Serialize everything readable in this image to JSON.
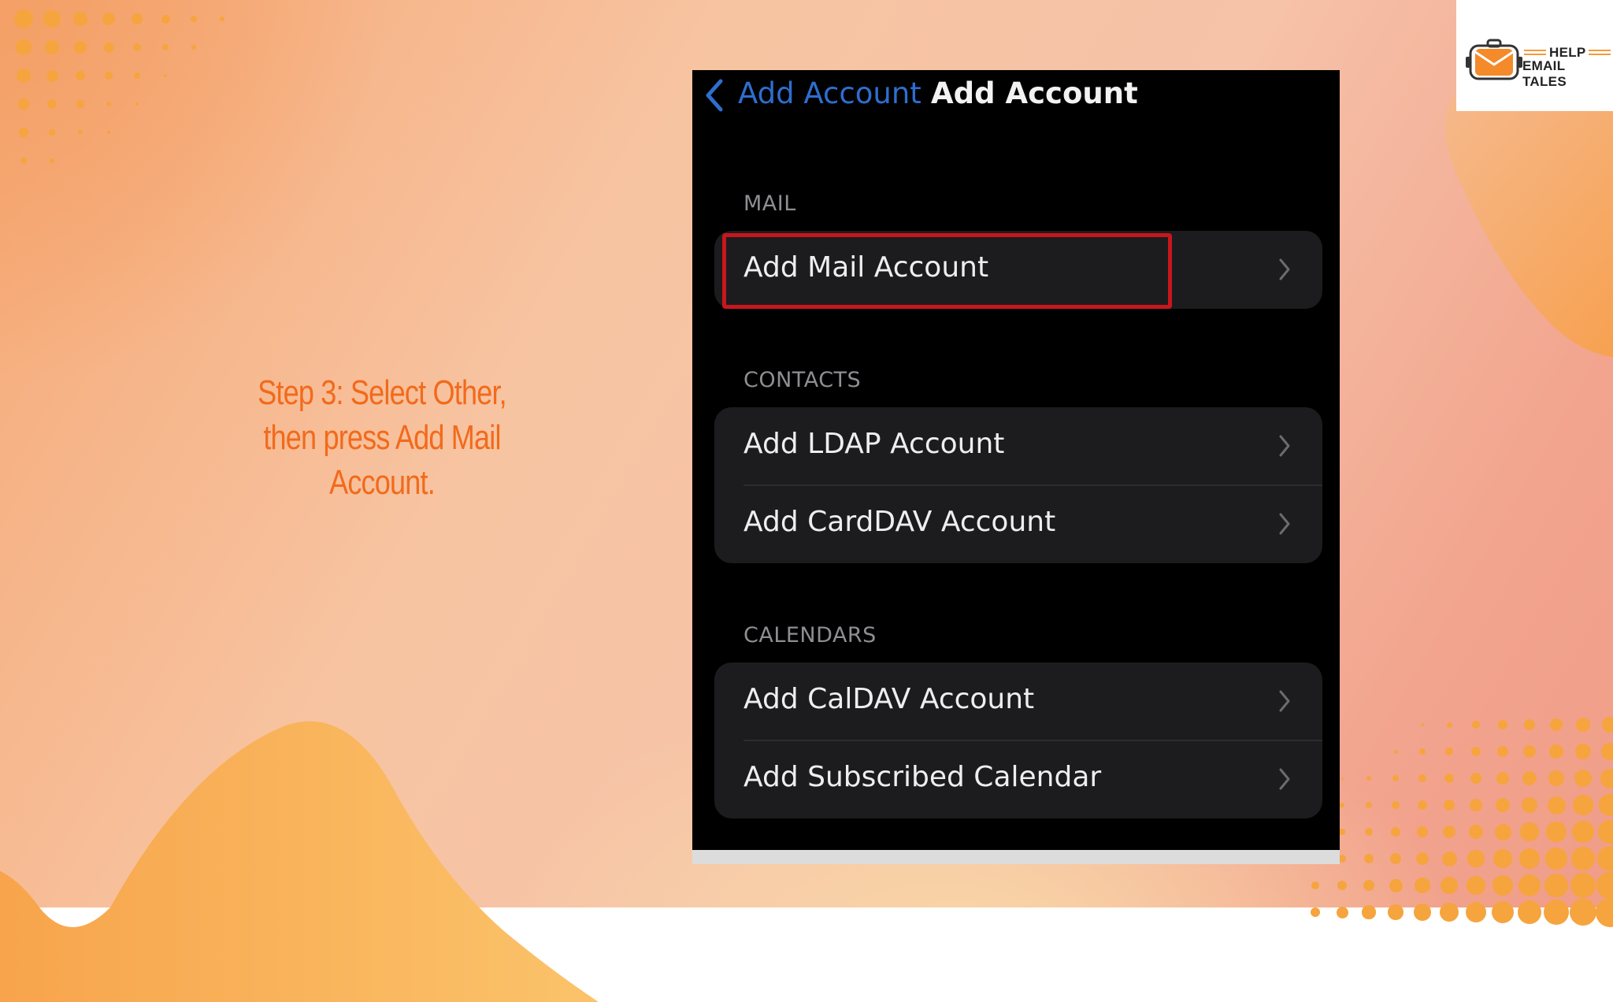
{
  "slide": {
    "step_text": "Step 3: Select Other, then press Add Mail Account."
  },
  "logo": {
    "line1": "HELP",
    "line2": "EMAIL TALES"
  },
  "phone": {
    "nav": {
      "back_label": "Add Account",
      "title": "Add Account"
    },
    "sections": [
      {
        "header": "MAIL",
        "rows": [
          "Add Mail Account"
        ]
      },
      {
        "header": "CONTACTS",
        "rows": [
          "Add LDAP Account",
          "Add CardDAV Account"
        ]
      },
      {
        "header": "CALENDARS",
        "rows": [
          "Add CalDAV Account",
          "Add Subscribed Calendar"
        ]
      }
    ]
  },
  "colors": {
    "accent_text": "#f26a1b",
    "highlight_box": "#c8161d",
    "ios_link": "#2e6ecf"
  }
}
